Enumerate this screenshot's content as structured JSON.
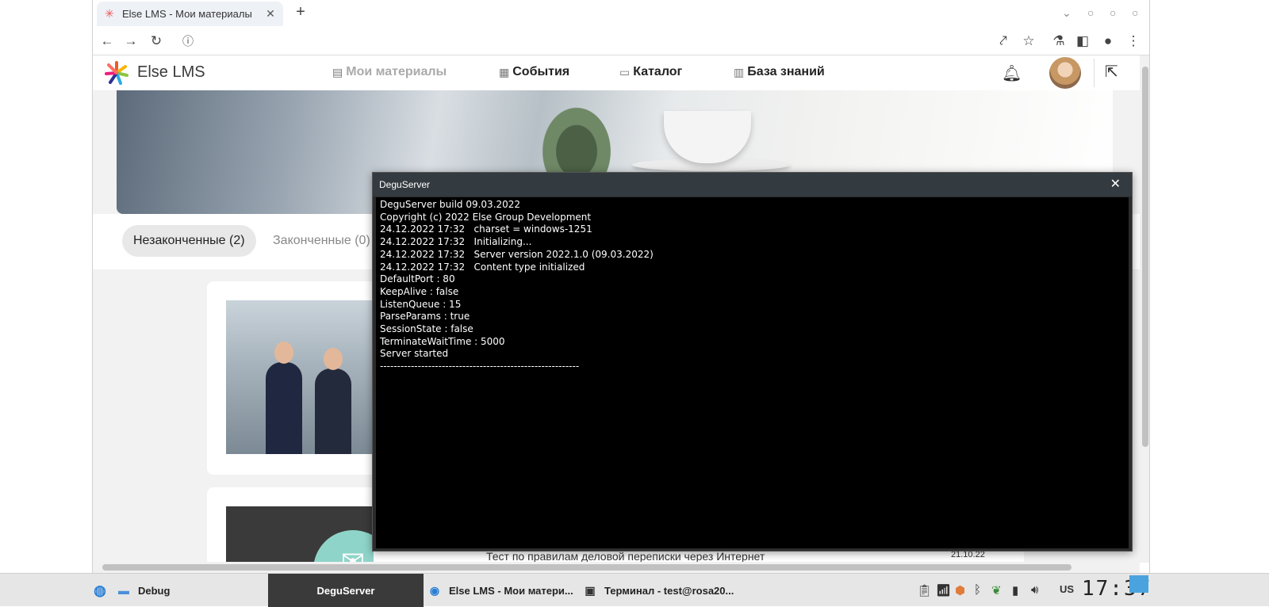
{
  "browser": {
    "tab_title": "Else LMS - Мои материалы",
    "new_tab_label": "+"
  },
  "site": {
    "logo_text": "Else LMS",
    "nav": [
      {
        "label": "Мои материалы",
        "icon": "document-icon",
        "active": true
      },
      {
        "label": "События",
        "icon": "calendar-icon",
        "active": false
      },
      {
        "label": "Каталог",
        "icon": "folder-icon",
        "active": false
      },
      {
        "label": "База знаний",
        "icon": "book-icon",
        "active": false
      }
    ],
    "filters": [
      {
        "label": "Незаконченные (2)",
        "selected": true
      },
      {
        "label": "Законченные (0)",
        "selected": false
      }
    ],
    "partial_item_title": "Тест по правилам деловой переписки через Интернет",
    "partial_item_date": "21.10.22"
  },
  "console": {
    "title": "DeguServer",
    "lines": [
      "DeguServer build 09.03.2022",
      "Copyright (c) 2022 Else Group Development",
      "24.12.2022 17:32   charset = windows-1251",
      "24.12.2022 17:32   Initializing...",
      "24.12.2022 17:32   Server version 2022.1.0 (09.03.2022)",
      "24.12.2022 17:32   Content type initialized",
      "DefaultPort : 80",
      "KeepAlive : false",
      "ListenQueue : 15",
      "ParseParams : true",
      "SessionState : false",
      "TerminateWaitTime : 5000",
      "Server started",
      "----------------------------------------------------------"
    ]
  },
  "taskbar": {
    "items": [
      {
        "label": "Debug"
      },
      {
        "label": "DeguServer"
      },
      {
        "label": "Else LMS - Мои матери..."
      },
      {
        "label": "Терминал - test@rosa20..."
      }
    ],
    "keyboard_layout": "US",
    "clock": "17:37"
  }
}
